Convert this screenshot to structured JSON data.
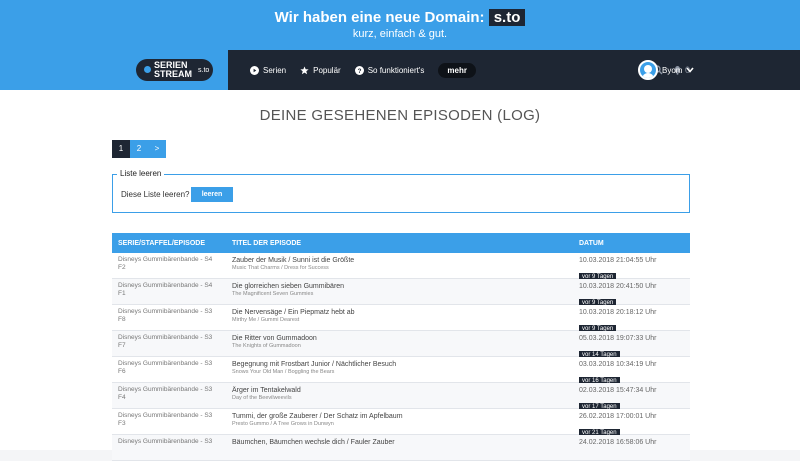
{
  "banner": {
    "text": "Wir haben eine neue Domain:",
    "domain": "s.to",
    "subtitle": "kurz, einfach & gut."
  },
  "nav": {
    "logo_line1": "SERIEN",
    "logo_line2": "STREAM",
    "logo_suffix": "s.to",
    "items": [
      {
        "label": "Serien",
        "icon": "play-icon"
      },
      {
        "label": "Populär",
        "icon": "star-icon"
      },
      {
        "label": "So funktioniert's",
        "icon": "question-icon"
      }
    ],
    "more_label": "mehr",
    "notification_count": "0",
    "username": "Byom"
  },
  "page": {
    "title": "DEINE GESEHENEN EPISODEN (LOG)",
    "pages": [
      "1",
      "2",
      ">"
    ],
    "active_page": "1"
  },
  "clear": {
    "legend": "Liste leeren",
    "question": "Diese Liste leeren?",
    "button": "leeren"
  },
  "table": {
    "headers": [
      "SERIE/STAFFEL/EPISODE",
      "TITEL DER EPISODE",
      "DATUM"
    ],
    "rows": [
      {
        "series": "Disneys Gummibärenbande - S4",
        "episode": "F2",
        "title": "Zauber der Musik / Sunni ist die Größte",
        "subtitle": "Music That Charms / Dress for Success",
        "date": "10.03.2018 21:04:55 Uhr",
        "ago": "vor 9 Tagen"
      },
      {
        "series": "Disneys Gummibärenbande - S4",
        "episode": "F1",
        "title": "Die glorreichen sieben Gummibären",
        "subtitle": "The Magnificent Seven Gummies",
        "date": "10.03.2018 20:41:50 Uhr",
        "ago": "vor 9 Tagen"
      },
      {
        "series": "Disneys Gummibärenbande - S3",
        "episode": "F8",
        "title": "Die Nervensäge / Ein Piepmatz hebt ab",
        "subtitle": "Mirthy Me / Gummi Dearest",
        "date": "10.03.2018 20:18:12 Uhr",
        "ago": "vor 9 Tagen"
      },
      {
        "series": "Disneys Gummibärenbande - S3",
        "episode": "F7",
        "title": "Die Ritter von Gummadoon",
        "subtitle": "The Knights of Gummadoon",
        "date": "05.03.2018 19:07:33 Uhr",
        "ago": "vor 14 Tagen"
      },
      {
        "series": "Disneys Gummibärenbande - S3",
        "episode": "F6",
        "title": "Begegnung mit Frostbart Junior / Nächtlicher Besuch",
        "subtitle": "Snows Your Old Man / Boggling the Bears",
        "date": "03.03.2018 10:34:19 Uhr",
        "ago": "vor 16 Tagen"
      },
      {
        "series": "Disneys Gummibärenbande - S3",
        "episode": "F4",
        "title": "Ärger im Tentakelwald",
        "subtitle": "Day of the Beevilweevils",
        "date": "02.03.2018 15:47:34 Uhr",
        "ago": "vor 17 Tagen"
      },
      {
        "series": "Disneys Gummibärenbande - S3",
        "episode": "F3",
        "title": "Tummi, der große Zauberer / Der Schatz im Apfelbaum",
        "subtitle": "Presto Gummo / A Tree Grows in Dunwyn",
        "date": "26.02.2018 17:00:01 Uhr",
        "ago": "vor 21 Tagen"
      },
      {
        "series": "Disneys Gummibärenbande - S3",
        "episode": "",
        "title": "Bäumchen, Bäumchen wechsle dich / Fauler Zauber",
        "subtitle": "",
        "date": "24.02.2018 16:58:06 Uhr",
        "ago": ""
      }
    ]
  }
}
